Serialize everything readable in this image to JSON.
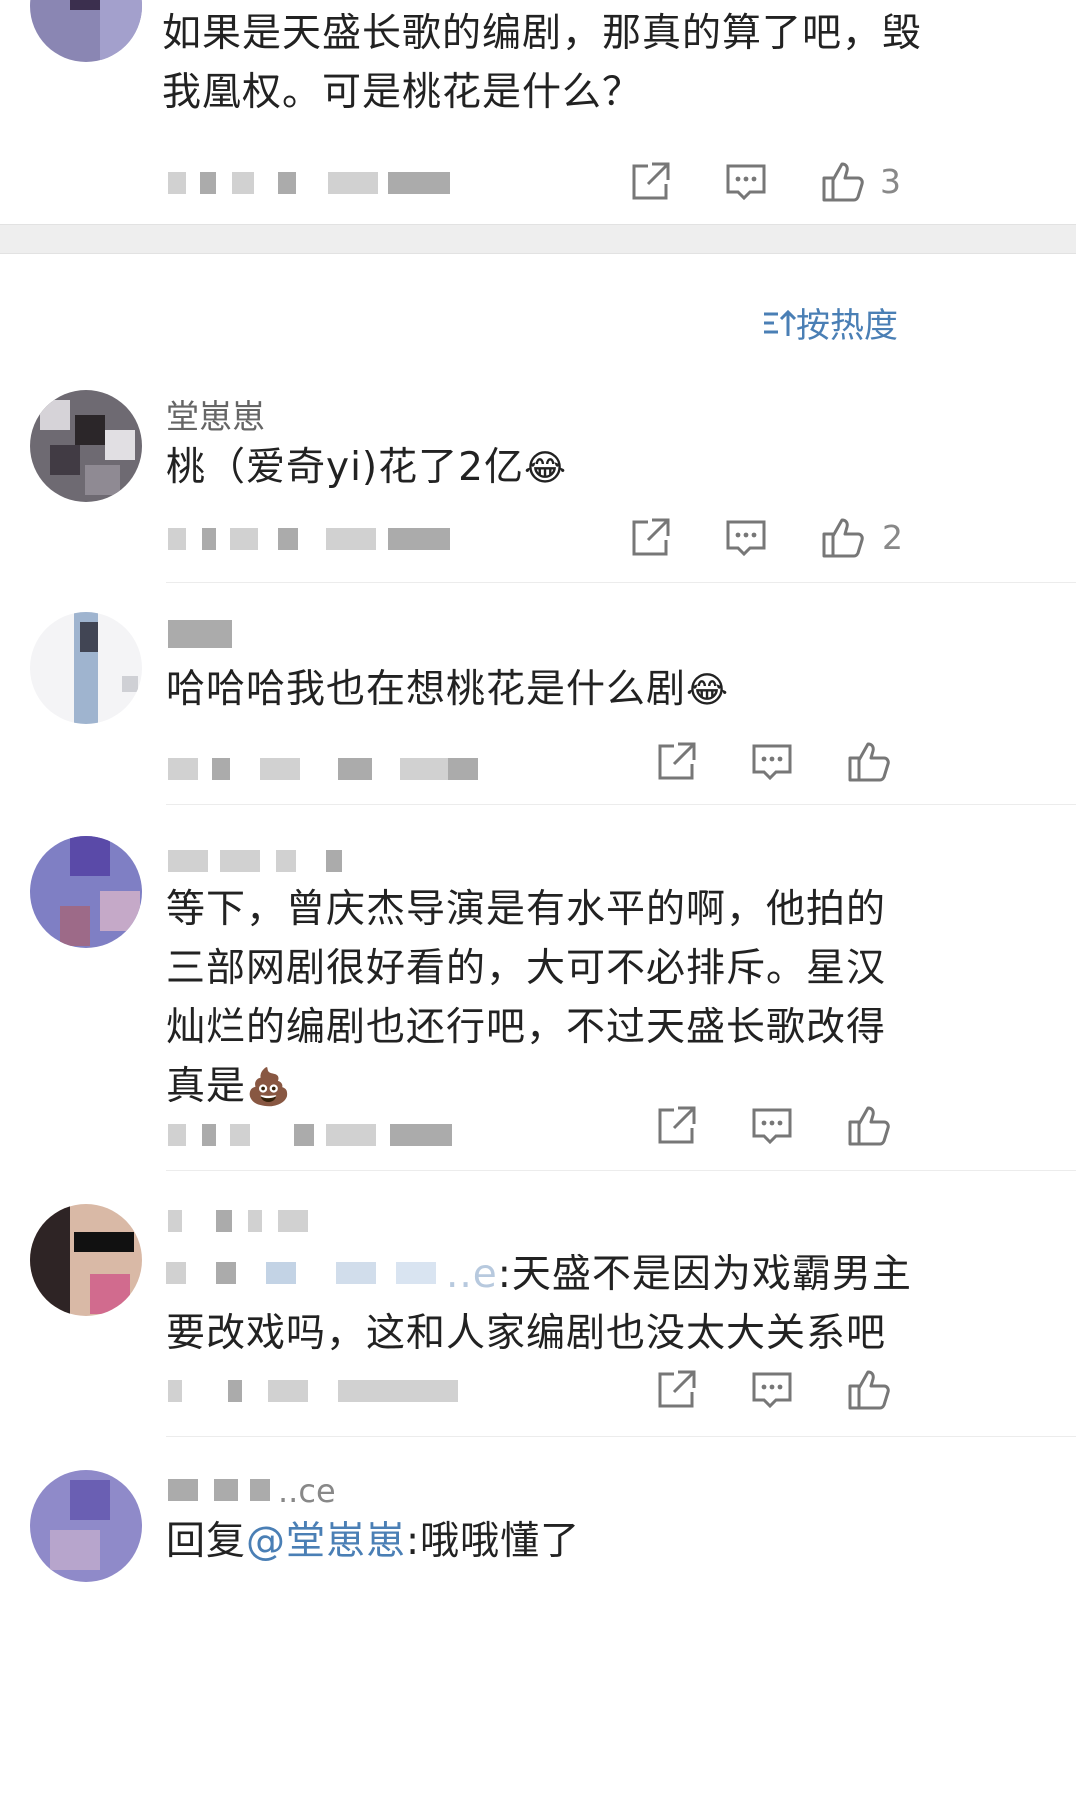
{
  "top_comment": {
    "text": "如果是天盛长歌的编剧，那真的算了吧，毁我凰权。可是桃花是什么？",
    "like_count": "3"
  },
  "sort": {
    "label": "按热度",
    "icon": "sort-icon"
  },
  "comments": [
    {
      "username": "堂崽崽",
      "text": "桃（爱奇yi)花了2亿",
      "emoji": "😂",
      "like_count": "2"
    },
    {
      "username": "",
      "text": "哈哈哈我也在想桃花是什么剧",
      "emoji": "😂",
      "like_count": ""
    },
    {
      "username": "",
      "text_lines": [
        "等下，曾庆杰导演是有水平的啊，他拍的",
        "三部网剧很好看的，大可不必排斥。星汉",
        "灿烂的编剧也还行吧，不过天盛长歌改得",
        "真是"
      ],
      "emoji": "💩",
      "like_count": ""
    },
    {
      "username": "",
      "reply_prefix": "..e",
      "text_lines": [
        ":天盛不是因为戏霸男主",
        "要改戏吗，这和人家编剧也没太大关系吧"
      ],
      "like_count": ""
    },
    {
      "username": "..ce",
      "reply_label": "回复",
      "mention": "@堂崽崽",
      "reply_text": ":哦哦懂了"
    }
  ],
  "icons": {
    "share": "share-icon",
    "comment": "comment-icon",
    "like": "thumbs-up-icon"
  },
  "colors": {
    "link": "#4a7fb5",
    "text": "#222222",
    "muted": "#888888"
  }
}
